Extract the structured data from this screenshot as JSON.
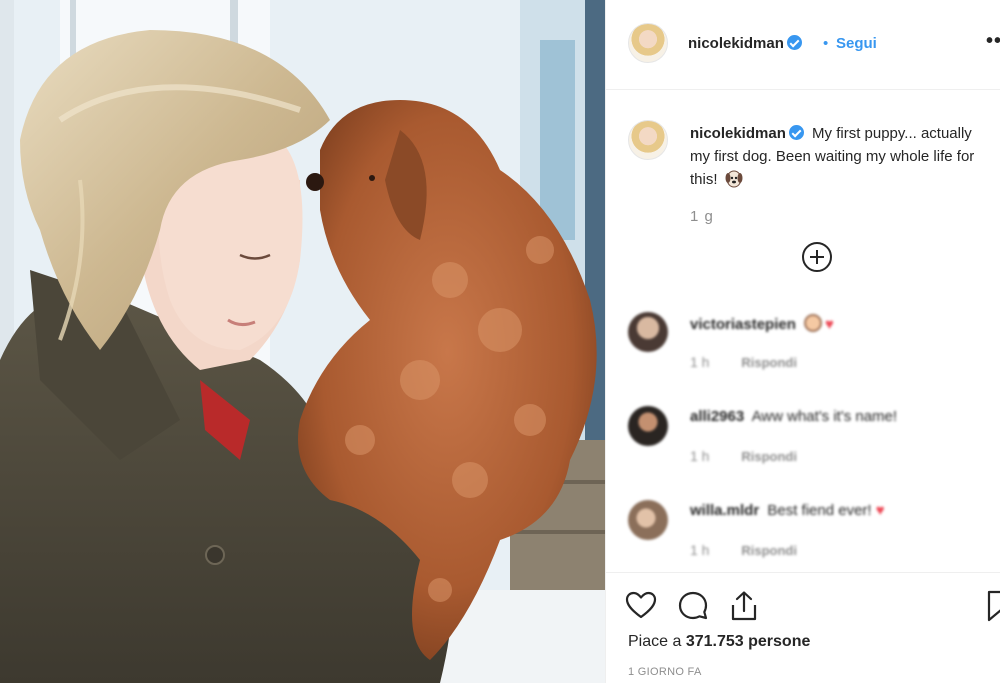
{
  "post": {
    "username": "nicolekidman",
    "separator": "•",
    "follow_label": "Segui",
    "more_label": "••"
  },
  "caption": {
    "username": "nicolekidman",
    "text": "My first puppy... actually my first dog. Been waiting my whole life for this!",
    "emoji": "dog-emoji",
    "time": "1 g"
  },
  "comments": [
    {
      "username": "victoriastepien",
      "text": "",
      "time": "1 h",
      "reply_label": "Rispondi",
      "emoji": "face-heart"
    },
    {
      "username": "alli2963",
      "text": "Aww what's it's name!",
      "time": "1 h",
      "reply_label": "Rispondi"
    },
    {
      "username": "willa.mldr",
      "text": "Best fiend ever!",
      "time": "1 h",
      "reply_label": "Rispondi",
      "emoji": "heart"
    }
  ],
  "actions": {
    "likes_prefix": "Piace a",
    "likes_count": "371.753",
    "likes_suffix": "persone",
    "date": "1 GIORNO FA"
  },
  "colors": {
    "accent": "#3897f0",
    "heart": "#ed4956",
    "muted": "#8e8e8e",
    "text": "#262626"
  },
  "icons": [
    "heart-outline-icon",
    "comment-icon",
    "share-icon",
    "bookmark-icon",
    "plus-circle-icon",
    "verified-badge-icon"
  ]
}
